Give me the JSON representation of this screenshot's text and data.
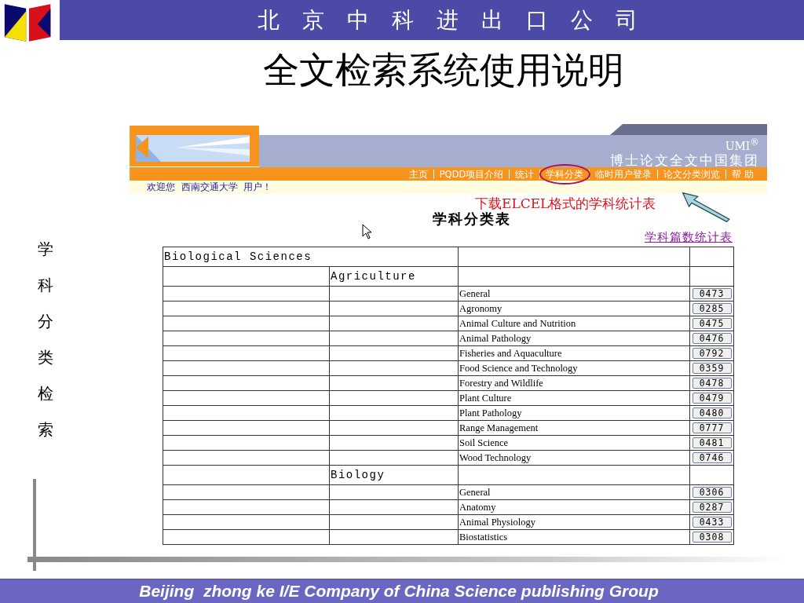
{
  "header": {
    "title": "北 京 中 科 进 出 口 公 司"
  },
  "slide_title": "全文检索系统使用说明",
  "side_label": "学科分类检索",
  "web_page": {
    "brand": "UMI$^{®}$",
    "banner_title": "博士论文全文中国集团",
    "nav": [
      {
        "label": "主页",
        "circled": false
      },
      {
        "label": "PQDD项目介绍",
        "circled": false
      },
      {
        "label": "统计",
        "circled": false
      },
      {
        "label": "学科分类",
        "circled": true
      },
      {
        "label": "临时用户登录",
        "circled": false
      },
      {
        "label": "论文分类浏览",
        "circled": false
      },
      {
        "label": "帮 助",
        "circled": false
      }
    ],
    "welcome": "欢迎您  西南交通大学  用户！",
    "heading": "学科分类表",
    "stats_link": "学科篇数统计表",
    "table": {
      "rows": [
        {
          "kind": "field",
          "name": "Biological Sciences"
        },
        {
          "kind": "subfield",
          "name": "Agriculture"
        },
        {
          "kind": "subject",
          "name": "General",
          "code": "0473"
        },
        {
          "kind": "subject",
          "name": "Agronomy",
          "code": "0285"
        },
        {
          "kind": "subject",
          "name": "Animal Culture and Nutrition",
          "code": "0475"
        },
        {
          "kind": "subject",
          "name": "Animal Pathology",
          "code": "0476"
        },
        {
          "kind": "subject",
          "name": "Fisheries and Aquaculture",
          "code": "0792"
        },
        {
          "kind": "subject",
          "name": "Food Science and Technology",
          "code": "0359"
        },
        {
          "kind": "subject",
          "name": "Forestry and Wildlife",
          "code": "0478"
        },
        {
          "kind": "subject",
          "name": "Plant Culture",
          "code": "0479"
        },
        {
          "kind": "subject",
          "name": "Plant Pathology",
          "code": "0480"
        },
        {
          "kind": "subject",
          "name": "Range Management",
          "code": "0777"
        },
        {
          "kind": "subject",
          "name": "Soil Science",
          "code": "0481"
        },
        {
          "kind": "subject",
          "name": "Wood Technology",
          "code": "0746"
        },
        {
          "kind": "subfield",
          "name": "Biology"
        },
        {
          "kind": "subject",
          "name": "General",
          "code": "0306"
        },
        {
          "kind": "subject",
          "name": "Anatomy",
          "code": "0287"
        },
        {
          "kind": "subject",
          "name": "Animal Physiology",
          "code": "0433"
        },
        {
          "kind": "subject",
          "name": "Biostatistics",
          "code": "0308"
        }
      ]
    }
  },
  "annotation": {
    "text": "下载ELCEL格式的学科统计表"
  },
  "footer": "Beijing  zhong ke I/E Company of China Science publishing Group"
}
